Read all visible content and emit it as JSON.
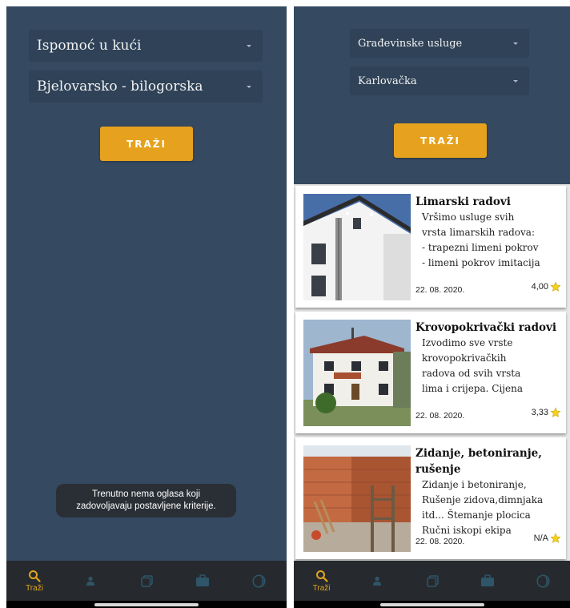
{
  "left_screen": {
    "category_select": {
      "value": "Ispomoć u kući"
    },
    "region_select": {
      "value": "Bjelovarsko - bilogorska"
    },
    "search_button": {
      "label": "TRAŽI"
    },
    "toast": {
      "line1": "Trenutno nema oglasa koji",
      "line2": "zadovoljavaju postavljene kriterije."
    }
  },
  "right_screen": {
    "category_select": {
      "value": "Građevinske usluge"
    },
    "region_select": {
      "value": "Karlovačka"
    },
    "search_button": {
      "label": "TRAŽI"
    },
    "listings": [
      {
        "title": "Limarski radovi",
        "description": "Vršimo usluge svih\nvrsta limarskih radova:\n- trapezni limeni pokrov\n- limeni pokrov imitacija",
        "date": "22. 08. 2020.",
        "rating": "4,00"
      },
      {
        "title": "Krovopokrivački radovi",
        "description": "Izvodimo sve vrste\nkrovopokrivačkih\nradova od svih vrsta\nlima i crijepa.   Cijena",
        "date": "22. 08. 2020.",
        "rating": "3,33"
      },
      {
        "title": "Zidanje, betoniranje, rušenje",
        "description": "Zidanje i betoniranje,\nRušenje zidova,dimnjaka\nitd... Štemanje plocica\nRučni iskopi ekipa",
        "date": "22. 08. 2020.",
        "rating": "N/A"
      }
    ]
  },
  "bottom_nav": {
    "items": [
      {
        "icon": "search-icon",
        "label": "Traži",
        "active": true
      },
      {
        "icon": "person-icon",
        "label": "",
        "active": false
      },
      {
        "icon": "listings-icon",
        "label": "",
        "active": false
      },
      {
        "icon": "briefcase-icon",
        "label": "",
        "active": false
      },
      {
        "icon": "moon-icon",
        "label": "",
        "active": false
      }
    ]
  },
  "colors": {
    "background": "#354960",
    "dropdown": "#2f4257",
    "accent": "#e6a21e",
    "nav_bar": "#262a2e",
    "star": "#f5d21e"
  }
}
